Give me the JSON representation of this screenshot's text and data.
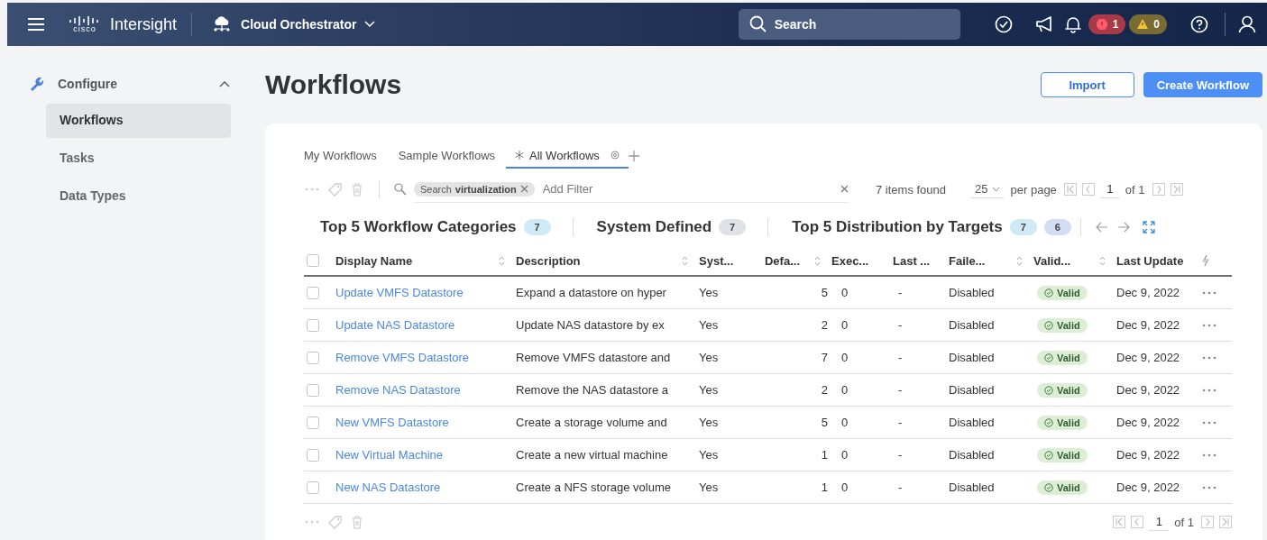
{
  "nav": {
    "logo_mark": "cisco",
    "product": "Intersight",
    "app": "Cloud Orchestrator",
    "search": {
      "placeholder": "Search"
    },
    "alerts": [
      {
        "kind": "critical",
        "count": "1"
      },
      {
        "kind": "warning",
        "count": "0"
      }
    ]
  },
  "sidebar": {
    "section": "Configure",
    "expanded": true,
    "items": [
      {
        "label": "Workflows",
        "selected": true
      },
      {
        "label": "Tasks",
        "selected": false
      },
      {
        "label": "Data Types",
        "selected": false
      }
    ]
  },
  "page": {
    "title": "Workflows",
    "buttons": [
      {
        "label": "Import",
        "kind": "secondary"
      },
      {
        "label": "Create Workflow",
        "kind": "primary"
      }
    ]
  },
  "tabs": [
    {
      "label": "My Workflows",
      "selected": false,
      "pinned": false
    },
    {
      "label": "Sample Workflows",
      "selected": false,
      "pinned": false
    },
    {
      "label": "All Workflows",
      "selected": true,
      "pinned": true
    }
  ],
  "filter": {
    "chip_key": "Search",
    "chip_value": "virtualization",
    "placeholder": "Add Filter",
    "items_found": "7 items found",
    "per_page": "25",
    "per_page_label": "per page",
    "page": "1",
    "page_of": "of 1"
  },
  "summary": [
    {
      "title": "Top 5 Workflow Categories",
      "counts": [
        {
          "value": "7",
          "color": "#cfe9f7"
        }
      ]
    },
    {
      "title": "System Defined",
      "counts": [
        {
          "value": "7",
          "color": "#e1e2e8"
        }
      ]
    },
    {
      "title": "Top 5 Distribution by Targets",
      "counts": [
        {
          "value": "7",
          "color": "#cfe9f7"
        },
        {
          "value": "6",
          "color": "#d3dcf5"
        }
      ]
    }
  ],
  "table": {
    "select_all_checked": false,
    "columns": [
      {
        "label": "Display Name",
        "sortable": true
      },
      {
        "label": "Description",
        "sortable": true
      },
      {
        "label": "Syst...",
        "sortable": false
      },
      {
        "label": "Defa...",
        "sortable": true
      },
      {
        "label": "Exec...",
        "sortable": false
      },
      {
        "label": "Last ...",
        "sortable": false
      },
      {
        "label": "Faile...",
        "sortable": true
      },
      {
        "label": "Valid...",
        "sortable": true
      },
      {
        "label": "Last Update",
        "sortable": false
      }
    ],
    "rows": [
      {
        "checked": false,
        "name": "Update VMFS Datastore",
        "description": "Expand a datastore on hyper",
        "system": "Yes",
        "default": "5",
        "executions": "0",
        "last": "-",
        "failed": "Disabled",
        "valid": "Valid",
        "updated": "Dec 9, 2022"
      },
      {
        "checked": false,
        "name": "Update NAS Datastore",
        "description": "Update NAS datastore by ex",
        "system": "Yes",
        "default": "2",
        "executions": "0",
        "last": "-",
        "failed": "Disabled",
        "valid": "Valid",
        "updated": "Dec 9, 2022"
      },
      {
        "checked": false,
        "name": "Remove VMFS Datastore",
        "description": "Remove VMFS datastore and",
        "system": "Yes",
        "default": "7",
        "executions": "0",
        "last": "-",
        "failed": "Disabled",
        "valid": "Valid",
        "updated": "Dec 9, 2022"
      },
      {
        "checked": false,
        "name": "Remove NAS Datastore",
        "description": "Remove the NAS datastore a",
        "system": "Yes",
        "default": "2",
        "executions": "0",
        "last": "-",
        "failed": "Disabled",
        "valid": "Valid",
        "updated": "Dec 9, 2022"
      },
      {
        "checked": false,
        "name": "New VMFS Datastore",
        "description": "Create a storage volume and",
        "system": "Yes",
        "default": "5",
        "executions": "0",
        "last": "-",
        "failed": "Disabled",
        "valid": "Valid",
        "updated": "Dec 9, 2022"
      },
      {
        "checked": false,
        "name": "New Virtual Machine",
        "description": "Create a new virtual machine",
        "system": "Yes",
        "default": "1",
        "executions": "0",
        "last": "-",
        "failed": "Disabled",
        "valid": "Valid",
        "updated": "Dec 9, 2022"
      },
      {
        "checked": false,
        "name": "New NAS Datastore",
        "description": "Create a NFS storage volume",
        "system": "Yes",
        "default": "1",
        "executions": "0",
        "last": "-",
        "failed": "Disabled",
        "valid": "Valid",
        "updated": "Dec 9, 2022"
      }
    ]
  },
  "footer": {
    "page": "1",
    "page_of": "of 1"
  }
}
